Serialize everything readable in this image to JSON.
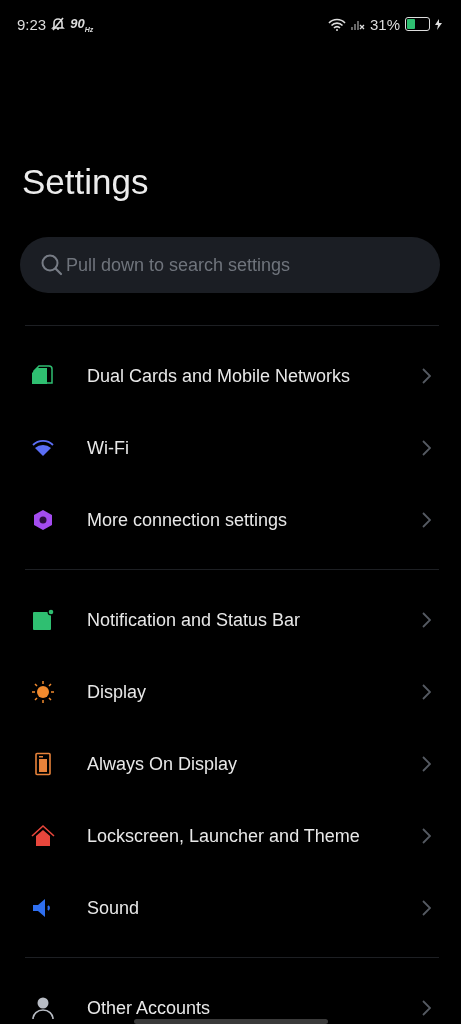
{
  "status_bar": {
    "time": "9:23",
    "refresh_rate": "90$_{Hz}$",
    "battery": "31%",
    "charging": true
  },
  "title": "Settings",
  "search": {
    "placeholder": "Pull down to search settings"
  },
  "groups": [
    {
      "items": [
        {
          "label": "Dual Cards and Mobile Networks"
        },
        {
          "label": "Wi-Fi"
        },
        {
          "label": "More connection settings"
        }
      ]
    },
    {
      "items": [
        {
          "label": "Notification and Status Bar"
        },
        {
          "label": "Display"
        },
        {
          "label": "Always On Display"
        },
        {
          "label": "Lockscreen, Launcher and Theme"
        },
        {
          "label": "Sound"
        }
      ]
    },
    {
      "items": [
        {
          "label": "Other Accounts"
        }
      ]
    }
  ]
}
